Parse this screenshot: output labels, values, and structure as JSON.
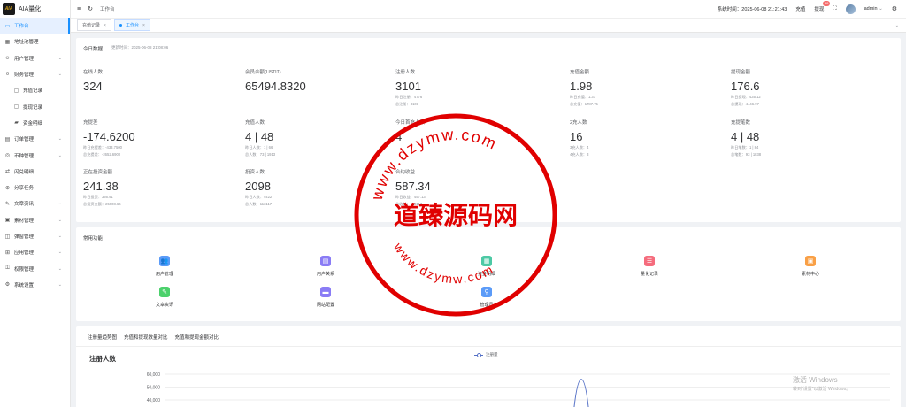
{
  "app": {
    "title": "AIA量化",
    "logo_text": "AIA"
  },
  "sidebar": {
    "items": [
      {
        "label": "工作台",
        "icon": "monitor-icon",
        "active": true
      },
      {
        "label": "地址池管理",
        "icon": "table-icon"
      },
      {
        "label": "用户管理",
        "icon": "user-icon",
        "chevron": true
      },
      {
        "label": "财务管理",
        "icon": "money-icon",
        "chevron": true
      },
      {
        "label": "充值记录",
        "icon": "folder-icon",
        "sub": true
      },
      {
        "label": "提现记录",
        "icon": "folder-icon",
        "sub": true
      },
      {
        "label": "资金明细",
        "icon": "wallet-icon",
        "sub": true
      },
      {
        "label": "订单管理",
        "icon": "order-icon",
        "chevron": true
      },
      {
        "label": "币种管理",
        "icon": "coin-icon",
        "chevron": true
      },
      {
        "label": "闪兑明细",
        "icon": "swap-icon"
      },
      {
        "label": "分享任务",
        "icon": "share-icon"
      },
      {
        "label": "文章资讯",
        "icon": "article-icon",
        "chevron": true
      },
      {
        "label": "素材管理",
        "icon": "image-icon",
        "chevron": true
      },
      {
        "label": "弹窗管理",
        "icon": "popup-icon",
        "chevron": true
      },
      {
        "label": "应用管理",
        "icon": "app-icon",
        "chevron": true
      },
      {
        "label": "权限管理",
        "icon": "lock-icon",
        "chevron": true
      },
      {
        "label": "系统设置",
        "icon": "gear-icon",
        "chevron": true
      }
    ]
  },
  "header": {
    "breadcrumb": "工作台",
    "system_time_label": "系统时间：",
    "system_time": "2025-06-08 21:21:43",
    "recharge_label": "充值",
    "withdraw_label": "提现",
    "withdraw_badge": "99",
    "user": "admin"
  },
  "tabs": [
    {
      "label": "充值记录",
      "active": false
    },
    {
      "label": "工作台",
      "active": true
    }
  ],
  "today": {
    "title": "今日数据",
    "updated": "更新时间：2025-06-08 21:08:06",
    "stats": [
      {
        "label": "在线人数",
        "value": "324",
        "sub": []
      },
      {
        "label": "会员余额(USDT)",
        "value": "65494.8320",
        "sub": []
      },
      {
        "label": "注册人数",
        "value": "3101",
        "sub": [
          "昨日注册：4776",
          "总注册：3101"
        ]
      },
      {
        "label": "充值金额",
        "value": "1.98",
        "sub": [
          "昨日充值：1.37",
          "总充值：1787.75"
        ]
      },
      {
        "label": "提现金额",
        "value": "176.6",
        "sub": [
          "昨日提现：435.12",
          "总提现：4446.97"
        ]
      },
      {
        "label": "充提差",
        "value": "-174.6200",
        "sub": [
          "昨日充提差：-433.7500",
          "总充提差：-2652.6900"
        ]
      },
      {
        "label": "充值人数",
        "value": "4 | 48",
        "sub": [
          "昨日人数：1 | 66",
          "总人数：73 | 1913"
        ]
      },
      {
        "label": "今日首充人数",
        "value": "4",
        "sub": []
      },
      {
        "label": "2充人数",
        "value": "16",
        "sub": [
          "3充人数：4",
          "4充人数：3"
        ]
      },
      {
        "label": "充提笔数",
        "value": "4 | 48",
        "sub": [
          "昨日笔数：1 | 84",
          "总笔数：93 | 1838"
        ]
      },
      {
        "label": "正在投资金额",
        "value": "241.38",
        "sub": [
          "昨日投资：336.91",
          "总投资金额：25908.66"
        ]
      },
      {
        "label": "投资人数",
        "value": "2098",
        "sub": [
          "昨日人数：4422",
          "总人数：113117"
        ]
      },
      {
        "label": "合约收益",
        "value": "587.34",
        "sub": [
          "昨日收益：497.13",
          "总收益：113117"
        ]
      }
    ]
  },
  "functions": {
    "title": "常用功能",
    "items": [
      {
        "label": "用户管理",
        "icon": "users-icon",
        "color": "#5b9bf8",
        "glyph": "👥"
      },
      {
        "label": "用户关系",
        "icon": "contacts-icon",
        "color": "#8a7cf5",
        "glyph": "▤"
      },
      {
        "label": "资金明细",
        "icon": "document-icon",
        "color": "#4dc9a5",
        "glyph": "▦"
      },
      {
        "label": "量化记录",
        "icon": "records-icon",
        "color": "#f56c7d",
        "glyph": "☰"
      },
      {
        "label": "素材中心",
        "icon": "folder-orange-icon",
        "color": "#f9a046",
        "glyph": "▣"
      },
      {
        "label": "文章资讯",
        "icon": "news-icon",
        "color": "#4cd16c",
        "glyph": "✎"
      },
      {
        "label": "网站配置",
        "icon": "config-icon",
        "color": "#8a7cf5",
        "glyph": "▬"
      },
      {
        "label": "管理员",
        "icon": "admin-icon",
        "color": "#5b9bf8",
        "glyph": "⚲"
      }
    ]
  },
  "chart_section": {
    "tabs": [
      "注册量趋势图",
      "充值和提现数量对比",
      "充值和提现金额对比"
    ],
    "title": "注册人数",
    "legend": "注册量"
  },
  "chart_data": {
    "type": "line",
    "title": "注册人数",
    "series": [
      {
        "name": "注册量"
      }
    ],
    "yticks": [
      "60,000",
      "50,000",
      "40,000"
    ],
    "peak_value": 56000
  },
  "stamp": {
    "center_text": "道臻源码网",
    "top_text": "www.dzymw.com",
    "bottom_text": "www.dzymw.com"
  },
  "os_watermark": {
    "line1": "激活 Windows",
    "line2": "转到\"设置\"以激活 Windows。"
  }
}
